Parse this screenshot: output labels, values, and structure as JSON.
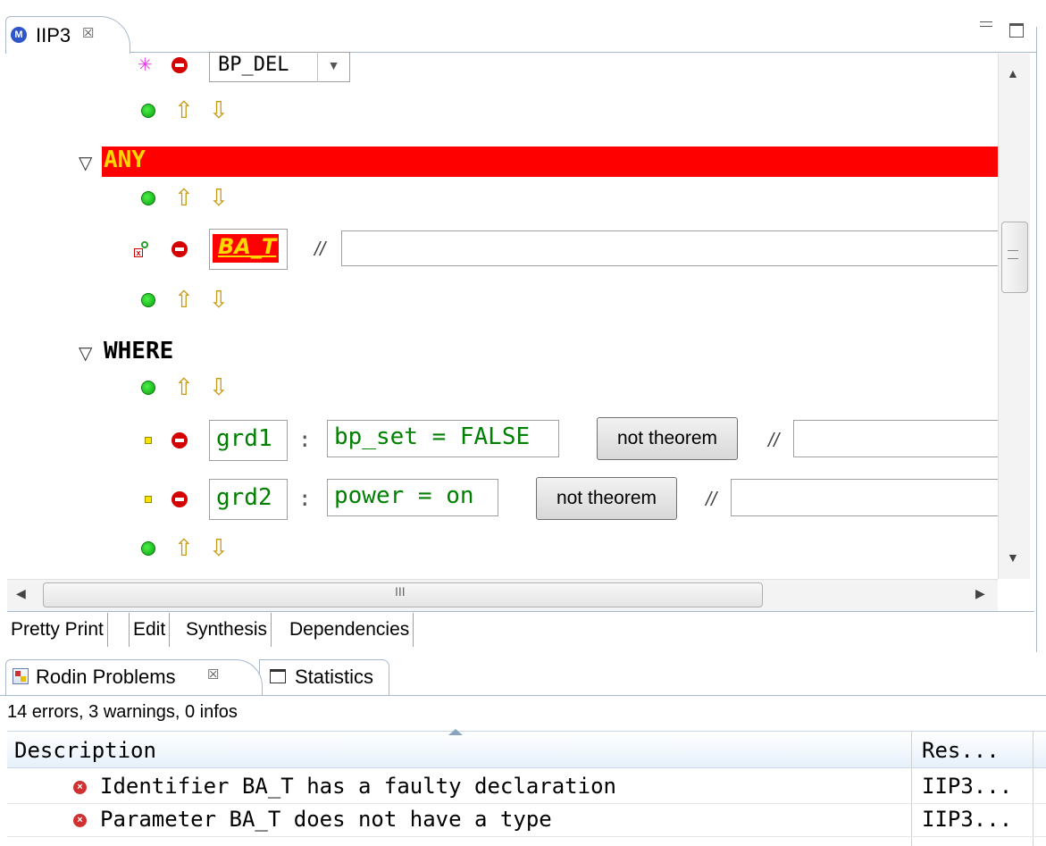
{
  "editor": {
    "tab_title": "IIP3",
    "close_glyph": "☒",
    "scroll_mark": "III"
  },
  "top_row": {
    "combo_value": "BP_DEL"
  },
  "sections": {
    "any_label": "ANY",
    "where_label": "WHERE"
  },
  "parameter": {
    "name": "BA_T",
    "comment_marker": "//"
  },
  "guards": [
    {
      "label": "grd1",
      "separator": ":",
      "predicate": "bp_set = FALSE",
      "theorem_button": "not theorem",
      "comment_marker": "//"
    },
    {
      "label": "grd2",
      "separator": ":",
      "predicate": "power = on",
      "theorem_button": "not theorem",
      "comment_marker": "//"
    }
  ],
  "editor_tabs": [
    "Pretty Print",
    "Edit",
    "Synthesis",
    "Dependencies"
  ],
  "problems": {
    "tab_label": "Rodin Problems",
    "close_glyph": "☒",
    "stats_tab_label": "Statistics",
    "summary": "14 errors, 3 warnings, 0 infos",
    "columns": [
      "Description",
      "Res..."
    ],
    "rows": [
      {
        "description": "Identifier BA_T has a faulty declaration",
        "resource": "IIP3..."
      },
      {
        "description": "Parameter BA_T does not have a type",
        "resource": "IIP3..."
      }
    ]
  },
  "colors": {
    "any_bar": "#ff0000",
    "any_text": "#ffd800",
    "predicate_text": "#008000",
    "tab_border": "#a8b8cc"
  },
  "icons": [
    "event-icon",
    "remove-icon",
    "add-icon",
    "move-up-icon",
    "move-down-icon",
    "error-decorated-parameter-icon",
    "guard-icon",
    "error-icon",
    "problems-view-icon",
    "statistics-view-icon"
  ]
}
